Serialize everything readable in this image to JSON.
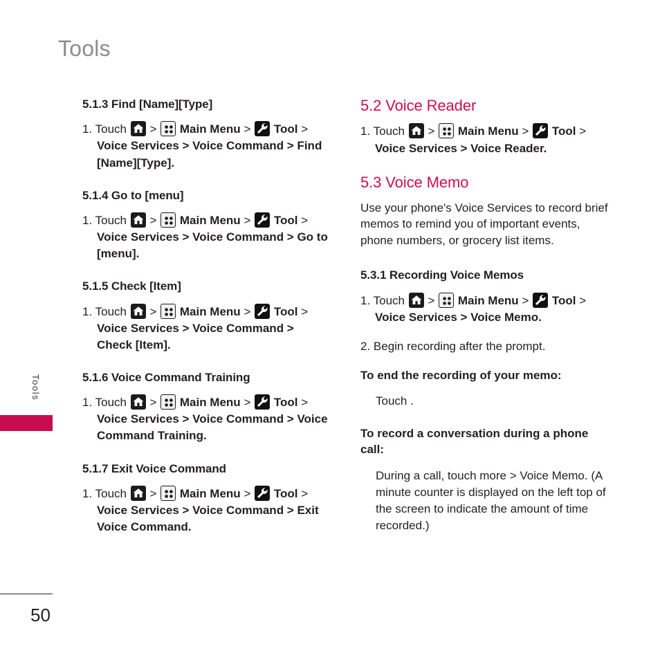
{
  "page": {
    "title": "Tools",
    "side_tab_label": "Tools",
    "number": "50",
    "accent_color": "#c80b4e",
    "heading_color": "#ce0e4e",
    "text_color": "#231f20",
    "title_color": "#8c8c8c"
  },
  "icons": {
    "home": "home-icon",
    "main_menu": "main-menu-grid-icon",
    "tool": "wrench-tool-icon"
  },
  "labels": {
    "touch": "Touch",
    "main_menu": "Main Menu",
    "tool": "Tool",
    "chevron": ">"
  },
  "left_column": [
    {
      "type": "heading3",
      "name": "heading-5-1-3",
      "text": "5.1.3 Find [Name][Type]"
    },
    {
      "type": "step",
      "name": "step-5-1-3-1",
      "number": "1.",
      "lead": "Touch",
      "tail": "Voice Services > Voice Command > Find [Name][Type]."
    },
    {
      "type": "heading3",
      "name": "heading-5-1-4",
      "text": "5.1.4 Go to [menu]"
    },
    {
      "type": "step",
      "name": "step-5-1-4-1",
      "number": "1.",
      "lead": "Touch",
      "tail": "Voice Services > Voice Command > Go to [menu]."
    },
    {
      "type": "heading3",
      "name": "heading-5-1-5",
      "text": "5.1.5 Check [Item]"
    },
    {
      "type": "step",
      "name": "step-5-1-5-1",
      "number": "1.",
      "lead": "Touch",
      "tail": "Voice Services > Voice Command > Check [Item]."
    },
    {
      "type": "heading3",
      "name": "heading-5-1-6",
      "text": "5.1.6 Voice Command Training"
    },
    {
      "type": "step",
      "name": "step-5-1-6-1",
      "number": "1.",
      "lead": "Touch",
      "tail": "Voice Services > Voice Command > Voice Command Training."
    },
    {
      "type": "heading3",
      "name": "heading-5-1-7",
      "text": "5.1.7 Exit Voice Command"
    },
    {
      "type": "step",
      "name": "step-5-1-7-1",
      "number": "1.",
      "lead": "Touch",
      "tail": "Voice Services > Voice Command > Exit Voice Command."
    }
  ],
  "right_column": {
    "section_5_2_heading": "5.2 Voice Reader",
    "section_5_2_step": {
      "number": "1.",
      "lead": "Touch",
      "tail": "Voice Services > Voice Reader."
    },
    "section_5_3_heading": "5.3 Voice Memo",
    "section_5_3_intro": "Use your phone's Voice Services to record brief memos to remind you of important events, phone numbers, or grocery list items.",
    "section_5_3_1_heading": "5.3.1 Recording Voice Memos",
    "section_5_3_1_step1": {
      "number": "1.",
      "lead": "Touch",
      "tail": "Voice Services > Voice Memo."
    },
    "section_5_3_1_step2": "2. Begin recording after the prompt.",
    "end_recording_heading": "To end the recording of your memo:",
    "end_recording_body": "Touch .",
    "record_call_heading": "To record a conversation during a phone call:",
    "record_call_body": "During a call, touch more > Voice Memo. (A minute counter is displayed on the left top of the screen to indicate the amount of time recorded.)"
  }
}
